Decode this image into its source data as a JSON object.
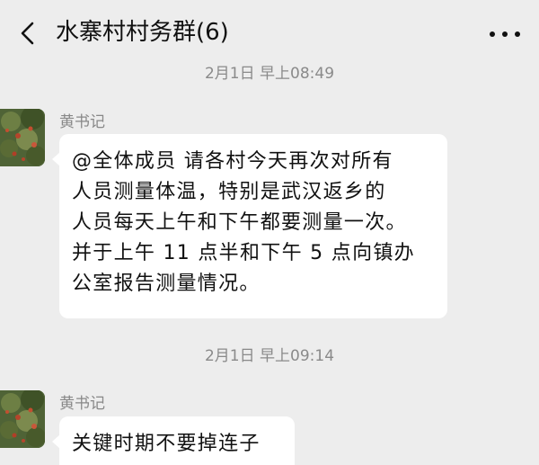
{
  "header": {
    "title": "水寨村村务群(6)",
    "back_icon": "chevron-left-icon",
    "more_icon": "ellipsis-icon"
  },
  "messages": [
    {
      "timestamp": "2月1日 早上08:49",
      "sender": "黄书记",
      "lines": [
        "@全体成员 请各村今天再次对所有",
        "人员测量体温，特别是武汉返乡的",
        "人员每天上午和下午都要测量一次。",
        "并于上午 11 点半和下午 5 点向镇办",
        "公室报告测量情况。"
      ]
    },
    {
      "timestamp": "2月1日 早上09:14",
      "sender": "黄书记",
      "lines": [
        "关键时期不要掉连子"
      ]
    }
  ],
  "colors": {
    "background": "#ededed",
    "bubble": "#ffffff",
    "meta_text": "#8a8a8a"
  }
}
